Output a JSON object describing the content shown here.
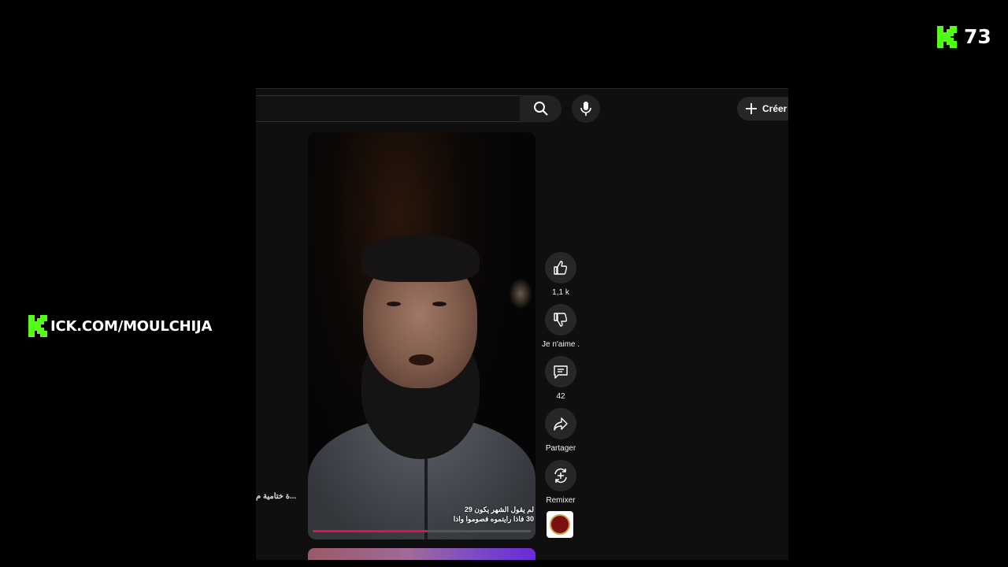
{
  "overlay": {
    "viewer_count": "73",
    "channel_url": "ICK.COM/MOULCHIJA",
    "brand_color": "#53fc18"
  },
  "header": {
    "search_icon": "search-icon",
    "mic_icon": "microphone-icon",
    "create_label": "Créer"
  },
  "sidebar": {
    "snippet": "...ة ختامية م"
  },
  "video": {
    "caption_line1": "لم يقول الشهر يكون 29",
    "caption_line2": "30 فاذا رايتموه فصوموا واذا",
    "progress": 0.52
  },
  "actions": [
    {
      "icon": "thumbs-up-icon",
      "label": "1,1 k"
    },
    {
      "icon": "thumbs-down-icon",
      "label": "Je n'aime ."
    },
    {
      "icon": "comment-icon",
      "label": "42"
    },
    {
      "icon": "share-icon",
      "label": "Partager"
    },
    {
      "icon": "remix-icon",
      "label": "Remixer"
    }
  ]
}
